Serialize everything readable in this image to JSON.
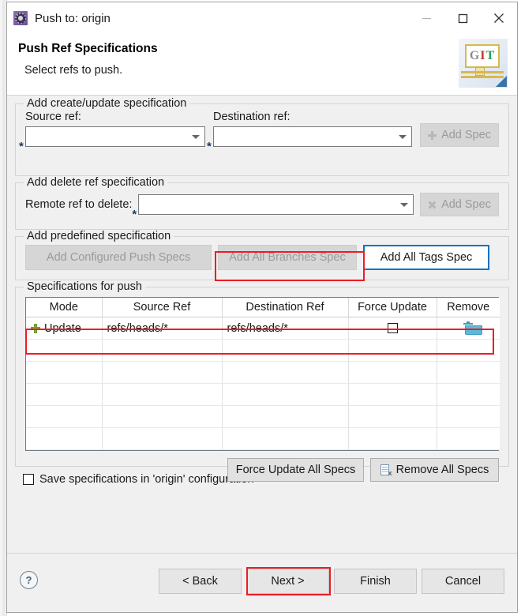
{
  "window": {
    "title": "Push to: origin",
    "icon": "gear-icon",
    "controls": {
      "minimize": "minimize-icon",
      "maximize": "maximize-icon",
      "close": "close-icon"
    }
  },
  "header": {
    "title": "Push Ref Specifications",
    "subtitle": "Select refs to push.",
    "logo": {
      "g": "G",
      "i": "I",
      "t": "T"
    }
  },
  "create_update_group": {
    "title": "Add create/update specification",
    "source_label": "Source ref:",
    "source_value": "",
    "source_required_marker": "*",
    "destination_label": "Destination ref:",
    "destination_value": "",
    "destination_required_marker": "*",
    "add_spec_label": "Add Spec",
    "add_spec_enabled": false,
    "add_spec_icon": "plus-icon"
  },
  "delete_group": {
    "title": "Add delete ref specification",
    "remote_label": "Remote ref to delete:",
    "remote_value": "",
    "remote_required_marker": "*",
    "add_spec_label": "Add Spec",
    "add_spec_enabled": false,
    "add_spec_icon": "x-icon"
  },
  "predefined_group": {
    "title": "Add predefined specification",
    "buttons": [
      {
        "label": "Add Configured Push Specs",
        "enabled": false,
        "focused": false
      },
      {
        "label": "Add All Branches Spec",
        "enabled": false,
        "focused": false
      },
      {
        "label": "Add All Tags Spec",
        "enabled": true,
        "focused": true
      }
    ]
  },
  "specs_group": {
    "title": "Specifications for push",
    "columns": [
      "Mode",
      "Source Ref",
      "Destination Ref",
      "Force Update",
      "Remove"
    ],
    "rows": [
      {
        "mode_icon": "plus-icon",
        "mode": "Update",
        "source_ref": "refs/heads/*",
        "destination_ref": "refs/heads/*",
        "force_update": false,
        "remove_icon": "trash-icon"
      }
    ],
    "empty_row_count": 5,
    "force_update_all_label": "Force Update All Specs",
    "remove_all_label": "Remove All Specs",
    "remove_all_icon": "document-delete-icon"
  },
  "save_option": {
    "label": "Save specifications in 'origin' configuration",
    "checked": false
  },
  "footer": {
    "help_icon": "help-icon",
    "help_glyph": "?",
    "buttons": [
      {
        "label": "< Back",
        "highlighted": false
      },
      {
        "label": "Next >",
        "highlighted": true
      },
      {
        "label": "Finish",
        "highlighted": false
      },
      {
        "label": "Cancel",
        "highlighted": false
      }
    ]
  },
  "annotations": {
    "highlight_color": "#ee1b24",
    "focus_color": "#0a73c2",
    "regions": [
      "add-all-branches-spec-button",
      "spec-table-first-row",
      "next-button"
    ]
  }
}
